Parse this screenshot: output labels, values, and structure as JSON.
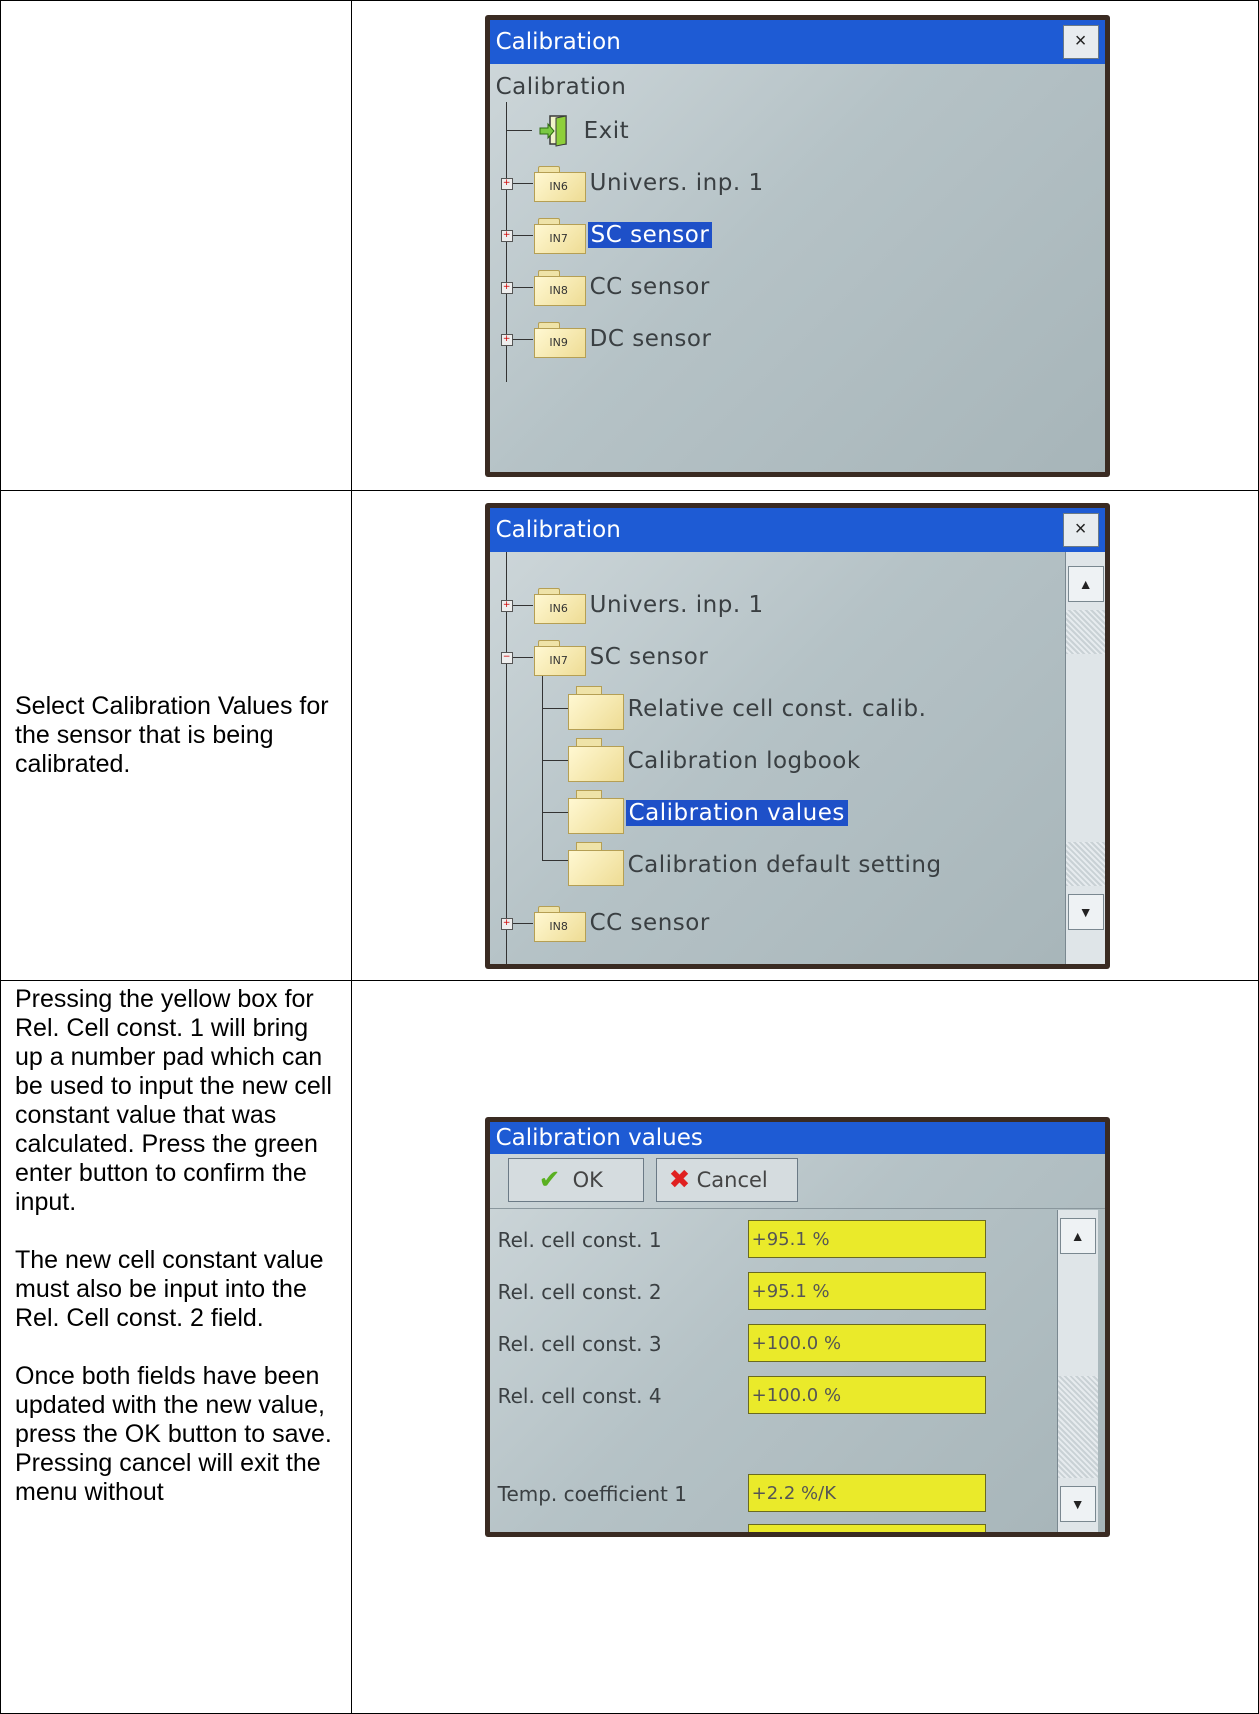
{
  "rows": [
    {
      "text": []
    },
    {
      "text": [
        "Select Calibration Values for the sensor that is being calibrated."
      ]
    },
    {
      "text": [
        "Pressing the yellow box for Rel. Cell const. 1 will bring up a number pad which can be used to input the new cell constant value that was calculated.  Press the green enter button to confirm the input.",
        "The new cell constant value must also be input into the Rel. Cell const. 2 field.",
        "Once both fields have been updated with the new value, press the OK button to save. Pressing cancel will exit the menu without"
      ]
    }
  ],
  "screen1": {
    "title": "Calibration",
    "close": "×",
    "root": "Calibration",
    "items": [
      {
        "icon": "exit-icon",
        "label": "Exit"
      },
      {
        "folder": "IN6",
        "label": "Univers. inp. 1"
      },
      {
        "folder": "IN7",
        "label": "SC sensor",
        "selected": true
      },
      {
        "folder": "IN8",
        "label": "CC sensor"
      },
      {
        "folder": "IN9",
        "label": "DC sensor"
      }
    ]
  },
  "screen2": {
    "title": "Calibration",
    "close": "×",
    "items": [
      {
        "folder": "IN6",
        "label": "Univers. inp. 1"
      },
      {
        "folder": "IN7",
        "label": "SC sensor"
      },
      {
        "label": "Relative cell const. calib."
      },
      {
        "label": "Calibration logbook"
      },
      {
        "label": "Calibration values",
        "selected": true
      },
      {
        "label": "Calibration default setting"
      },
      {
        "folder": "IN8",
        "label": "CC sensor"
      }
    ],
    "scroll_up": "▲",
    "scroll_down": "▼"
  },
  "screen3": {
    "title": "Calibration values",
    "ok_label": "OK",
    "cancel_label": "Cancel",
    "fields": [
      {
        "label": "Rel. cell const. 1",
        "value": "+95.1 %"
      },
      {
        "label": "Rel. cell const. 2",
        "value": "+95.1 %"
      },
      {
        "label": "Rel. cell const. 3",
        "value": "+100.0 %"
      },
      {
        "label": "Rel. cell const. 4",
        "value": "+100.0 %"
      },
      {
        "label": "Temp. coefficient 1",
        "value": "+2.2 %/K"
      }
    ],
    "scroll_up": "▲",
    "scroll_down": "▼"
  }
}
